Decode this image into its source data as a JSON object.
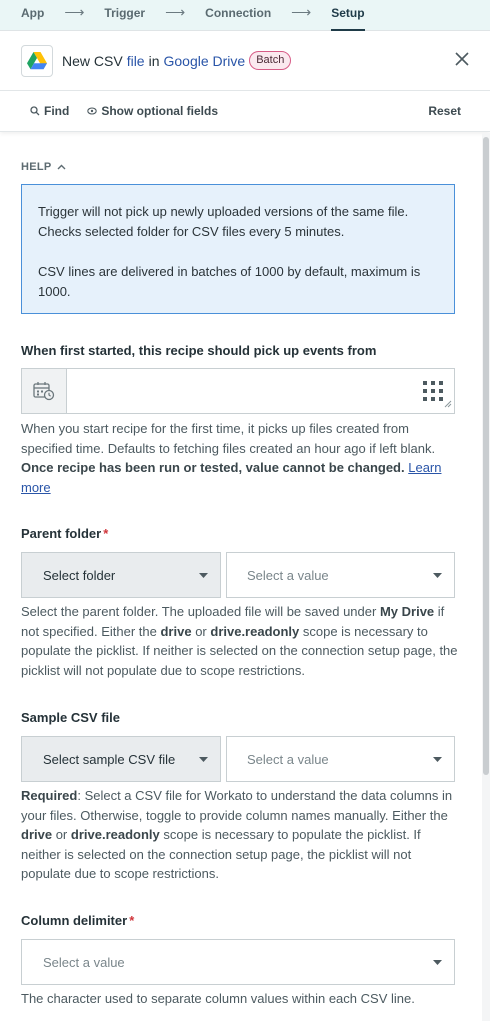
{
  "stepper": {
    "steps": [
      "App",
      "Trigger",
      "Connection",
      "Setup"
    ],
    "arrow": "⟶",
    "active": "Setup"
  },
  "header": {
    "title_parts": [
      "New CSV",
      "file",
      "in",
      "Google Drive"
    ],
    "badge": "Batch",
    "logo_icon": "google-drive-icon",
    "close_icon": "close-icon"
  },
  "toolbar": {
    "find_label": "Find",
    "optional_label": "Show optional fields",
    "reset_label": "Reset"
  },
  "help": {
    "header": "HELP",
    "line1": "Trigger will not pick up newly uploaded versions of the same file. Checks selected folder for CSV files every 5 minutes.",
    "line2": "CSV lines are delivered in batches of 1000 by default, maximum is 1000."
  },
  "first_started": {
    "label": "When first started, this recipe should pick up events from",
    "value": "",
    "hint_text": "When you start recipe for the first time, it picks up files created from specified time. Defaults to fetching files created an hour ago if left blank.",
    "hint_bold": "Once recipe has been run or tested, value cannot be changed.",
    "hint_link": "Learn more"
  },
  "parent_folder": {
    "label": "Parent folder",
    "required": "*",
    "button_label": "Select folder",
    "placeholder": "Select a value",
    "hint_1": "Select the parent folder. The uploaded file will be saved under",
    "hint_b1": "My Drive",
    "hint_2": "if not specified. Either the",
    "hint_b2": "drive",
    "hint_3": "or",
    "hint_b3": "drive.readonly",
    "hint_4": "scope is necessary to populate the picklist. If neither is selected on the connection setup page, the picklist will not populate due to scope restrictions."
  },
  "sample_csv": {
    "label": "Sample CSV file",
    "button_label": "Select sample CSV file",
    "placeholder": "Select a value",
    "hint_b0": "Required",
    "hint_1": ": Select a CSV file for Workato to understand the data columns in your files. Otherwise, toggle to provide column names manually. Either the",
    "hint_b1": "drive",
    "hint_2": "or",
    "hint_b2": "drive.readonly",
    "hint_3": "scope is necessary to populate the picklist. If neither is selected on the connection setup page, the picklist will not populate due to scope restrictions."
  },
  "column_delimiter": {
    "label": "Column delimiter",
    "required": "*",
    "placeholder": "Select a value",
    "hint": "The character used to separate column values within each CSV line."
  }
}
